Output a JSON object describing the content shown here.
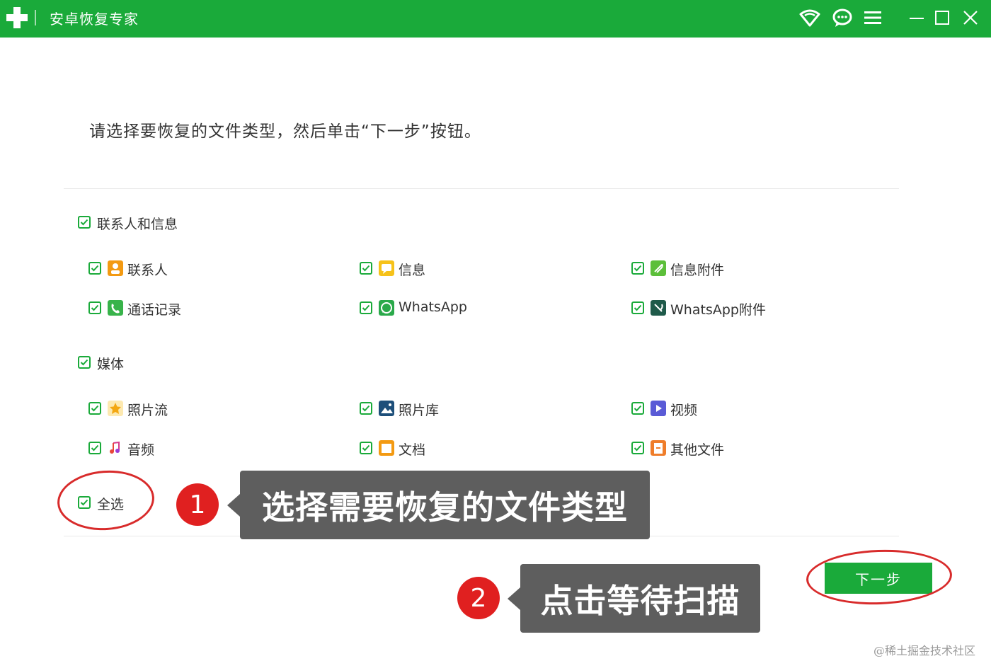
{
  "window": {
    "title": "安卓恢复专家",
    "brand_color": "#1aaa3a",
    "controls": [
      "wifi-icon",
      "chat-icon",
      "menu-icon",
      "minimize-icon",
      "maximize-icon",
      "close-icon"
    ]
  },
  "instruction": "请选择要恢复的文件类型，然后单击“下一步”按钮。",
  "groups": [
    {
      "label": "联系人和信息",
      "checked": true,
      "items": [
        {
          "label": "联系人",
          "icon": "contacts-icon",
          "checked": true
        },
        {
          "label": "信息",
          "icon": "messages-icon",
          "checked": true
        },
        {
          "label": "信息附件",
          "icon": "message-attachment-icon",
          "checked": true
        },
        {
          "label": "通话记录",
          "icon": "call-log-icon",
          "checked": true
        },
        {
          "label": "WhatsApp",
          "icon": "whatsapp-icon",
          "checked": true
        },
        {
          "label": "WhatsApp附件",
          "icon": "whatsapp-attachment-icon",
          "checked": true
        }
      ]
    },
    {
      "label": "媒体",
      "checked": true,
      "items": [
        {
          "label": "照片流",
          "icon": "photo-stream-icon",
          "checked": true
        },
        {
          "label": "照片库",
          "icon": "photo-library-icon",
          "checked": true
        },
        {
          "label": "视频",
          "icon": "video-icon",
          "checked": true
        },
        {
          "label": "音频",
          "icon": "audio-icon",
          "checked": true
        },
        {
          "label": "文档",
          "icon": "document-icon",
          "checked": true
        },
        {
          "label": "其他文件",
          "icon": "other-files-icon",
          "checked": true
        }
      ]
    }
  ],
  "select_all": {
    "label": "全选",
    "checked": true
  },
  "next_button": "下一步",
  "annotations": [
    {
      "number": "1",
      "text": "选择需要恢复的文件类型"
    },
    {
      "number": "2",
      "text": "点击等待扫描"
    }
  ],
  "watermark": "@稀土掘金技术社区"
}
